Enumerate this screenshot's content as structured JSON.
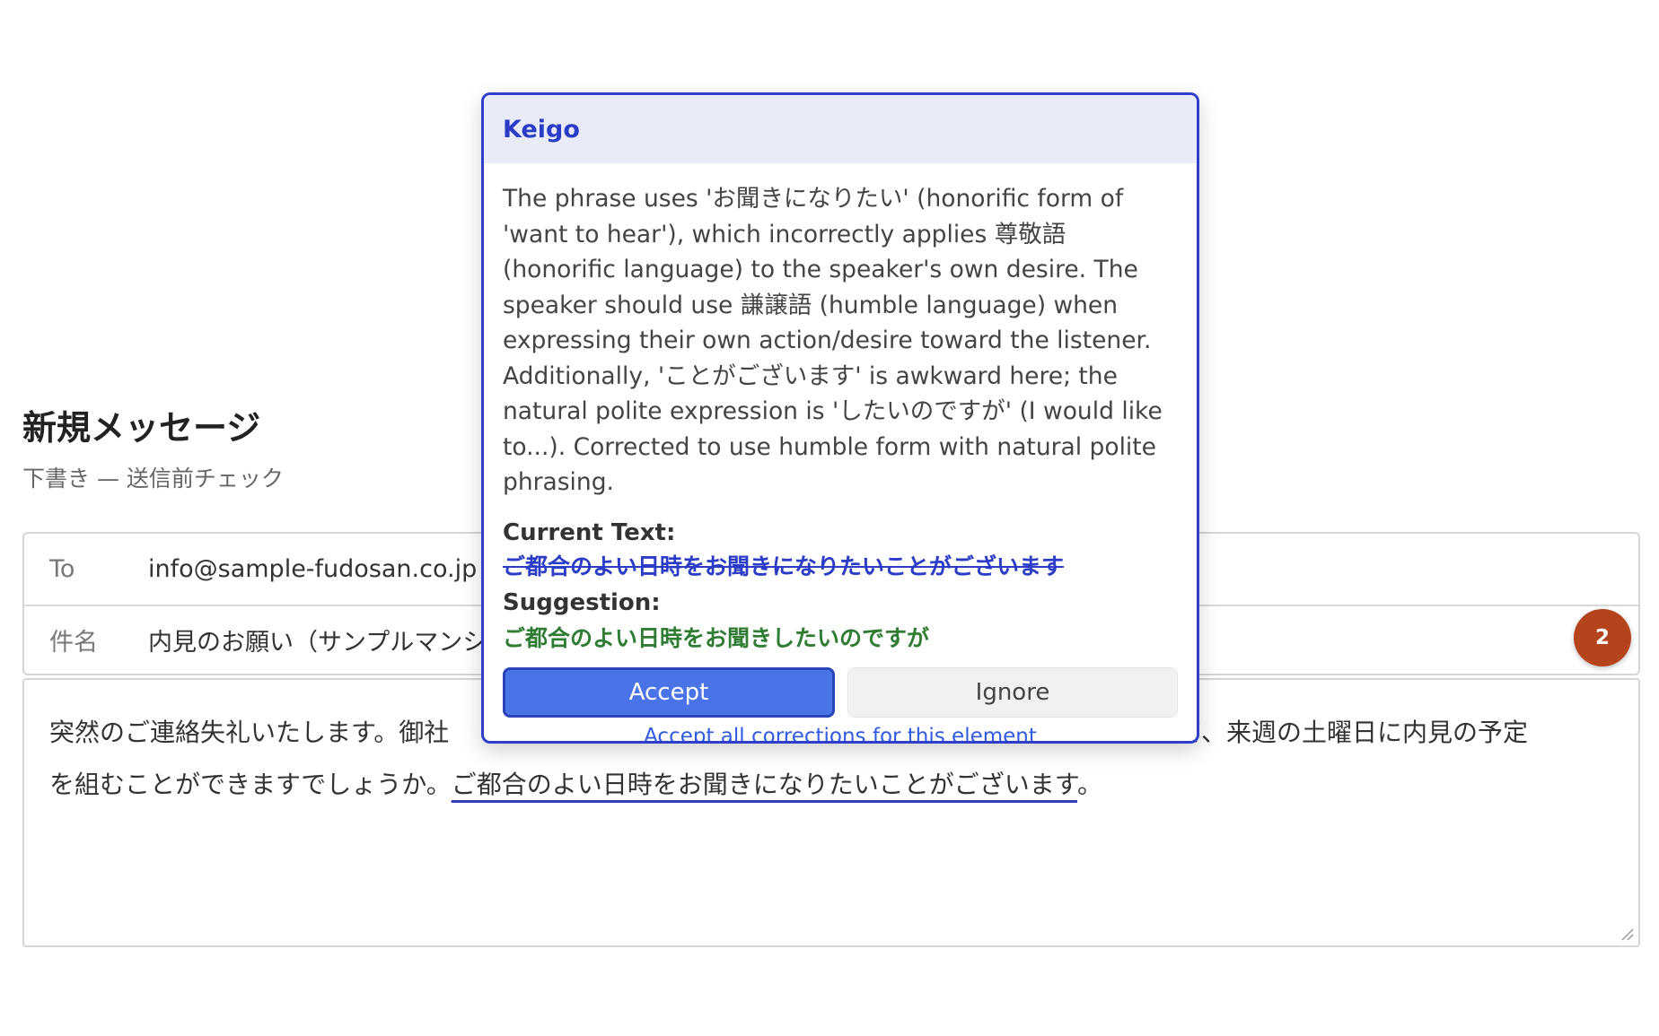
{
  "compose": {
    "title": "新規メッセージ",
    "subtitle": "下書き — 送信前チェック"
  },
  "headers": {
    "to_label": "To",
    "to_value": "info@sample-fudosan.co.jp",
    "subject_label": "件名",
    "subject_value": "内見のお願い（サンプルマンシ"
  },
  "badge": {
    "count": "2"
  },
  "body": {
    "text_line1": "突然のご連絡失礼いたします。御社",
    "text_line1_end": "いて、来週の土曜日に内見の予定",
    "text_line2_start": "を組むことができますでしょうか。",
    "flagged_phrase": "ご都合のよい日時をお聞きになりたいことがございます",
    "text_line2_end": "。"
  },
  "popup": {
    "title": "Keigo",
    "explanation": "The phrase uses 'お聞きになりたい' (honorific form of 'want to hear'), which incorrectly applies 尊敬語 (honorific language) to the speaker's own desire. The speaker should use 謙譲語 (humble language) when expressing their own action/desire toward the listener. Additionally, 'ことがございます' is awkward here; the natural polite expression is 'したいのですが' (I would like to...). Corrected to use humble form with natural polite phrasing.",
    "current_label": "Current Text:",
    "current_text": "ご都合のよい日時をお聞きになりたいことがございます",
    "suggestion_label": "Suggestion:",
    "suggestion_text": "ご都合のよい日時をお聞きしたいのですが",
    "accept_label": "Accept",
    "ignore_label": "Ignore",
    "accept_all_label": "Accept all corrections for this element"
  },
  "colors": {
    "accent": "#2b3cc6",
    "accept_button": "#4a73e8",
    "suggestion": "#2e7d32",
    "badge": "#b5441c"
  }
}
